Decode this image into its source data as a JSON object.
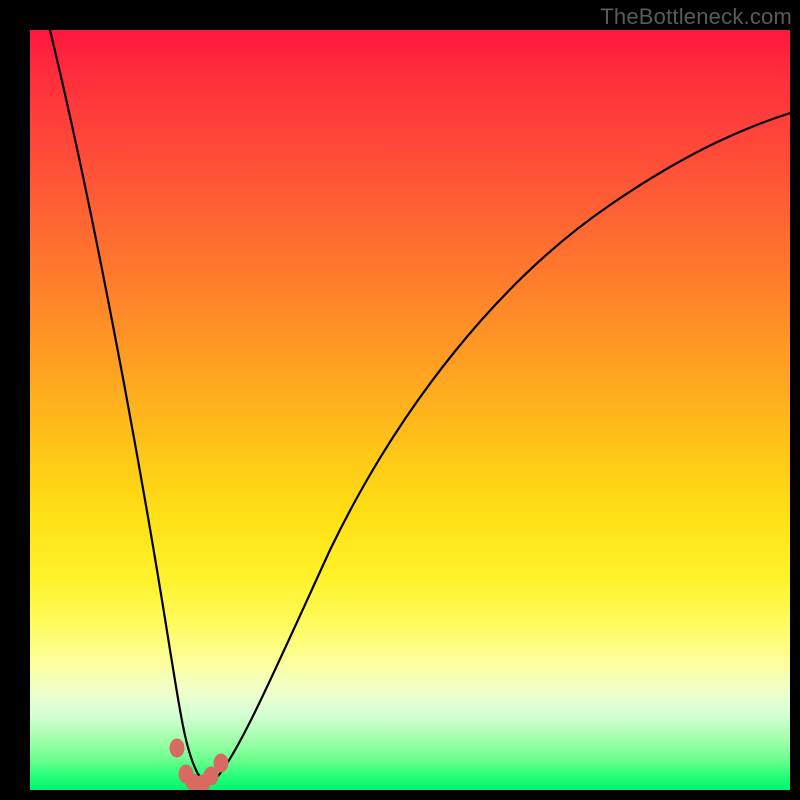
{
  "watermark": "TheBottleneck.com",
  "colors": {
    "background": "#000000",
    "curve": "#000000",
    "knots": "#d86a62",
    "gradient_top": "#ff173e",
    "gradient_bottom": "#00f66e"
  },
  "chart_data": {
    "type": "line",
    "title": "",
    "xlabel": "",
    "ylabel": "",
    "xlim": [
      0,
      100
    ],
    "ylim": [
      0,
      100
    ],
    "x": [
      0,
      3,
      6,
      9,
      12,
      15,
      17.5,
      19,
      20.5,
      22,
      23.5,
      25,
      27,
      29,
      32,
      36,
      41,
      47,
      54,
      62,
      72,
      84,
      100
    ],
    "values": [
      100,
      83,
      67,
      51,
      36,
      22,
      12,
      6,
      2,
      0.5,
      0.5,
      1.5,
      4,
      8,
      14,
      23,
      34,
      45,
      55,
      65,
      74,
      82,
      89
    ],
    "annotations": {
      "knots_x": [
        19.2,
        20.3,
        21.0,
        22.2,
        23.3,
        24.6
      ],
      "knots_y": [
        5.0,
        1.5,
        0.6,
        0.6,
        1.6,
        3.2
      ]
    }
  }
}
